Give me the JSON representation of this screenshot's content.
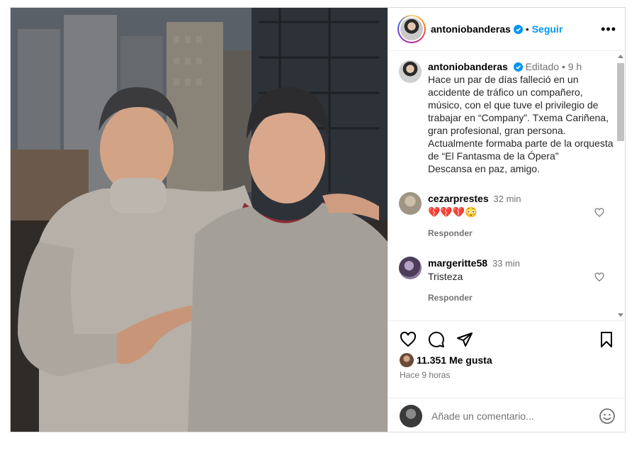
{
  "post": {
    "username": "antoniobanderas",
    "follow_label": "Seguir",
    "separator": "•",
    "more_label": "•••",
    "caption": {
      "username": "antoniobanderas",
      "edited": "Editado",
      "time": "9 h",
      "text": "Hace un par de días falleció en un accidente de tráfico un compañero, músico, con el que tuve el privilegio de trabajar en “Company”. Txema Cariñena, gran profesional, gran persona. Actualmente formaba parte de la orquesta de “El Fantasma de la Ópera”\nDescansa en paz, amigo."
    },
    "comments": [
      {
        "username": "cezarprestes",
        "time": "32 min",
        "text": "💔💔💔😳",
        "reply_label": "Responder"
      },
      {
        "username": "margeritte58",
        "time": "33 min",
        "text": "Tristeza",
        "reply_label": "Responder"
      }
    ],
    "likes_text": "11.351 Me gusta",
    "posted_ago": "Hace 9 horas",
    "add_comment_placeholder": "Añade un comentario...",
    "icons": [
      "heart-icon",
      "comment-icon",
      "share-icon",
      "bookmark-icon",
      "emoji-icon",
      "verified-icon",
      "more-icon"
    ],
    "colors": {
      "accent": "#0095f6",
      "muted": "#737373",
      "text": "#262626",
      "border": "#dbdbdb"
    }
  }
}
